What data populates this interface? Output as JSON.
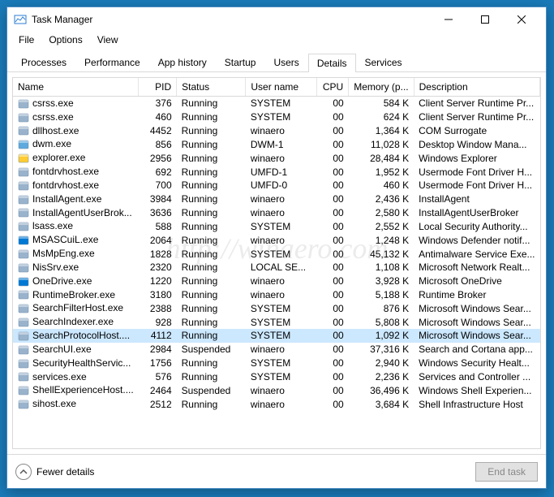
{
  "window": {
    "title": "Task Manager"
  },
  "menu": [
    "File",
    "Options",
    "View"
  ],
  "tabs": [
    "Processes",
    "Performance",
    "App history",
    "Startup",
    "Users",
    "Details",
    "Services"
  ],
  "activeTab": 5,
  "columns": [
    "Name",
    "PID",
    "Status",
    "User name",
    "CPU",
    "Memory (p...",
    "Description"
  ],
  "selectedIndex": 17,
  "processes": [
    {
      "name": "csrss.exe",
      "pid": 376,
      "status": "Running",
      "user": "SYSTEM",
      "cpu": "00",
      "mem": "584 K",
      "desc": "Client Server Runtime Pr..."
    },
    {
      "name": "csrss.exe",
      "pid": 460,
      "status": "Running",
      "user": "SYSTEM",
      "cpu": "00",
      "mem": "624 K",
      "desc": "Client Server Runtime Pr..."
    },
    {
      "name": "dllhost.exe",
      "pid": 4452,
      "status": "Running",
      "user": "winaero",
      "cpu": "00",
      "mem": "1,364 K",
      "desc": "COM Surrogate"
    },
    {
      "name": "dwm.exe",
      "pid": 856,
      "status": "Running",
      "user": "DWM-1",
      "cpu": "00",
      "mem": "11,028 K",
      "desc": "Desktop Window Mana..."
    },
    {
      "name": "explorer.exe",
      "pid": 2956,
      "status": "Running",
      "user": "winaero",
      "cpu": "00",
      "mem": "28,484 K",
      "desc": "Windows Explorer"
    },
    {
      "name": "fontdrvhost.exe",
      "pid": 692,
      "status": "Running",
      "user": "UMFD-1",
      "cpu": "00",
      "mem": "1,952 K",
      "desc": "Usermode Font Driver H..."
    },
    {
      "name": "fontdrvhost.exe",
      "pid": 700,
      "status": "Running",
      "user": "UMFD-0",
      "cpu": "00",
      "mem": "460 K",
      "desc": "Usermode Font Driver H..."
    },
    {
      "name": "InstallAgent.exe",
      "pid": 3984,
      "status": "Running",
      "user": "winaero",
      "cpu": "00",
      "mem": "2,436 K",
      "desc": "InstallAgent"
    },
    {
      "name": "InstallAgentUserBrok...",
      "pid": 3636,
      "status": "Running",
      "user": "winaero",
      "cpu": "00",
      "mem": "2,580 K",
      "desc": "InstallAgentUserBroker"
    },
    {
      "name": "lsass.exe",
      "pid": 588,
      "status": "Running",
      "user": "SYSTEM",
      "cpu": "00",
      "mem": "2,552 K",
      "desc": "Local Security Authority..."
    },
    {
      "name": "MSASCuiL.exe",
      "pid": 2064,
      "status": "Running",
      "user": "winaero",
      "cpu": "00",
      "mem": "1,248 K",
      "desc": "Windows Defender notif..."
    },
    {
      "name": "MsMpEng.exe",
      "pid": 1828,
      "status": "Running",
      "user": "SYSTEM",
      "cpu": "00",
      "mem": "45,132 K",
      "desc": "Antimalware Service Exe..."
    },
    {
      "name": "NisSrv.exe",
      "pid": 2320,
      "status": "Running",
      "user": "LOCAL SE...",
      "cpu": "00",
      "mem": "1,108 K",
      "desc": "Microsoft Network Realt..."
    },
    {
      "name": "OneDrive.exe",
      "pid": 1220,
      "status": "Running",
      "user": "winaero",
      "cpu": "00",
      "mem": "3,928 K",
      "desc": "Microsoft OneDrive"
    },
    {
      "name": "RuntimeBroker.exe",
      "pid": 3180,
      "status": "Running",
      "user": "winaero",
      "cpu": "00",
      "mem": "5,188 K",
      "desc": "Runtime Broker"
    },
    {
      "name": "SearchFilterHost.exe",
      "pid": 2388,
      "status": "Running",
      "user": "SYSTEM",
      "cpu": "00",
      "mem": "876 K",
      "desc": "Microsoft Windows Sear..."
    },
    {
      "name": "SearchIndexer.exe",
      "pid": 928,
      "status": "Running",
      "user": "SYSTEM",
      "cpu": "00",
      "mem": "5,808 K",
      "desc": "Microsoft Windows Sear..."
    },
    {
      "name": "SearchProtocolHost....",
      "pid": 4112,
      "status": "Running",
      "user": "SYSTEM",
      "cpu": "00",
      "mem": "1,092 K",
      "desc": "Microsoft Windows Sear..."
    },
    {
      "name": "SearchUI.exe",
      "pid": 2984,
      "status": "Suspended",
      "user": "winaero",
      "cpu": "00",
      "mem": "37,316 K",
      "desc": "Search and Cortana app..."
    },
    {
      "name": "SecurityHealthServic...",
      "pid": 1756,
      "status": "Running",
      "user": "SYSTEM",
      "cpu": "00",
      "mem": "2,940 K",
      "desc": "Windows Security Healt..."
    },
    {
      "name": "services.exe",
      "pid": 576,
      "status": "Running",
      "user": "SYSTEM",
      "cpu": "00",
      "mem": "2,236 K",
      "desc": "Services and Controller ..."
    },
    {
      "name": "ShellExperienceHost....",
      "pid": 2464,
      "status": "Suspended",
      "user": "winaero",
      "cpu": "00",
      "mem": "36,496 K",
      "desc": "Windows Shell Experien..."
    },
    {
      "name": "sihost.exe",
      "pid": 2512,
      "status": "Running",
      "user": "winaero",
      "cpu": "00",
      "mem": "3,684 K",
      "desc": "Shell Infrastructure Host"
    }
  ],
  "footer": {
    "fewer": "Fewer details",
    "endtask": "End task"
  },
  "watermark": "http://winaero.com"
}
